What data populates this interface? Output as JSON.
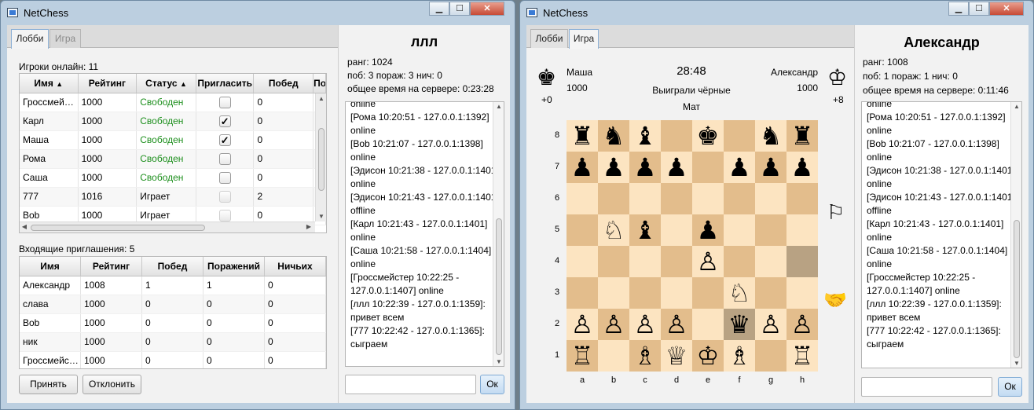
{
  "left_window": {
    "title": "NetChess",
    "tabs": [
      {
        "label": "Лобби",
        "active": true
      },
      {
        "label": "Игра",
        "active": false
      }
    ],
    "online_label": "Игроки онлайн: 11",
    "players_table": {
      "columns": [
        "Имя",
        "Рейтинг",
        "Статус",
        "Пригласить",
        "Побед",
        "По"
      ],
      "rows": [
        {
          "name": "Гроссмейстер",
          "rating": "1000",
          "status": "Свободен",
          "free": true,
          "invite": false,
          "enabled": true,
          "wins": "0"
        },
        {
          "name": "Карл",
          "rating": "1000",
          "status": "Свободен",
          "free": true,
          "invite": true,
          "enabled": true,
          "wins": "0"
        },
        {
          "name": "Маша",
          "rating": "1000",
          "status": "Свободен",
          "free": true,
          "invite": true,
          "enabled": true,
          "wins": "0"
        },
        {
          "name": "Рома",
          "rating": "1000",
          "status": "Свободен",
          "free": true,
          "invite": false,
          "enabled": true,
          "wins": "0"
        },
        {
          "name": "Саша",
          "rating": "1000",
          "status": "Свободен",
          "free": true,
          "invite": false,
          "enabled": true,
          "wins": "0"
        },
        {
          "name": "777",
          "rating": "1016",
          "status": "Играет",
          "free": false,
          "invite": false,
          "enabled": false,
          "wins": "2"
        },
        {
          "name": "Bob",
          "rating": "1000",
          "status": "Играет",
          "free": false,
          "invite": false,
          "enabled": false,
          "wins": "0"
        }
      ]
    },
    "incoming_label": "Входящие приглашения: 5",
    "invites_table": {
      "columns": [
        "Имя",
        "Рейтинг",
        "Побед",
        "Поражений",
        "Ничьих"
      ],
      "rows": [
        [
          "Александр",
          "1008",
          "1",
          "1",
          "0"
        ],
        [
          "слава",
          "1000",
          "0",
          "0",
          "0"
        ],
        [
          "Bob",
          "1000",
          "0",
          "0",
          "0"
        ],
        [
          "ник",
          "1000",
          "0",
          "0",
          "0"
        ],
        [
          "Гроссмейстер",
          "1000",
          "0",
          "0",
          "0"
        ]
      ]
    },
    "accept_label": "Принять",
    "decline_label": "Отклонить",
    "side": {
      "name": "ллл",
      "rank": "ранг: 1024",
      "stats": "поб: 3 пораж: 3 нич: 0",
      "time": "общее время на сервере: 0:23:28",
      "ok_label": "Ок"
    }
  },
  "right_window": {
    "title": "NetChess",
    "tabs": [
      {
        "label": "Лобби",
        "active": false
      },
      {
        "label": "Игра",
        "active": true
      }
    ],
    "game": {
      "black_player": "Маша",
      "black_rating": "1000",
      "black_advantage": "+0",
      "white_player": "Александр",
      "white_rating": "1000",
      "white_advantage": "+8",
      "clock": "28:48",
      "result": "Выиграли чёрные",
      "result_detail": "Мат",
      "ranks": [
        "8",
        "7",
        "6",
        "5",
        "4",
        "3",
        "2",
        "1"
      ],
      "files": [
        "a",
        "b",
        "c",
        "d",
        "e",
        "f",
        "g",
        "h"
      ],
      "board": [
        [
          "♜",
          "♞",
          "♝",
          "",
          "♚",
          "",
          "♞",
          "♜"
        ],
        [
          "♟",
          "♟",
          "♟",
          "♟",
          "",
          "♟",
          "♟",
          "♟"
        ],
        [
          "",
          "",
          "",
          "",
          "",
          "",
          "",
          ""
        ],
        [
          "",
          "♘",
          "♝",
          "",
          "♟",
          "",
          "",
          ""
        ],
        [
          "",
          "",
          "",
          "",
          "♙",
          "",
          "",
          ""
        ],
        [
          "",
          "",
          "",
          "",
          "",
          "♘",
          "",
          ""
        ],
        [
          "♙",
          "♙",
          "♙",
          "♙",
          "",
          "♛",
          "♙",
          "♙"
        ],
        [
          "♖",
          "",
          "♗",
          "♕",
          "♔",
          "♗",
          "",
          "♖"
        ]
      ],
      "highlight": [
        "h4",
        "f2"
      ],
      "black_king_icon": "black-king-icon",
      "white_king_icon": "white-king-icon",
      "resign_icon": "white-flag-icon",
      "draw_icon": "handshake-icon"
    },
    "side": {
      "name": "Александр",
      "rank": "ранг: 1008",
      "stats": "поб: 1 пораж: 1 нич: 0",
      "time": "общее время на сервере: 0:11:46",
      "ok_label": "Ок"
    }
  },
  "chat_lines": [
    "online",
    "[Рома 10:20:51 - 127.0.0.1:1392] online",
    "[Bob 10:21:07 - 127.0.0.1:1398] online",
    "[Эдисон 10:21:38 - 127.0.0.1:1401] online",
    "[Эдисон 10:21:43 - 127.0.0.1:1401] offline",
    "[Карл 10:21:43 - 127.0.0.1:1401] online",
    "[Саша 10:21:58 - 127.0.0.1:1404] online",
    "[Гроссмейстер 10:22:25 - 127.0.0.1:1407] online",
    "[ллл 10:22:39 - 127.0.0.1:1359]: привет всем",
    "[777 10:22:42 - 127.0.0.1:1365]: сыграем"
  ]
}
